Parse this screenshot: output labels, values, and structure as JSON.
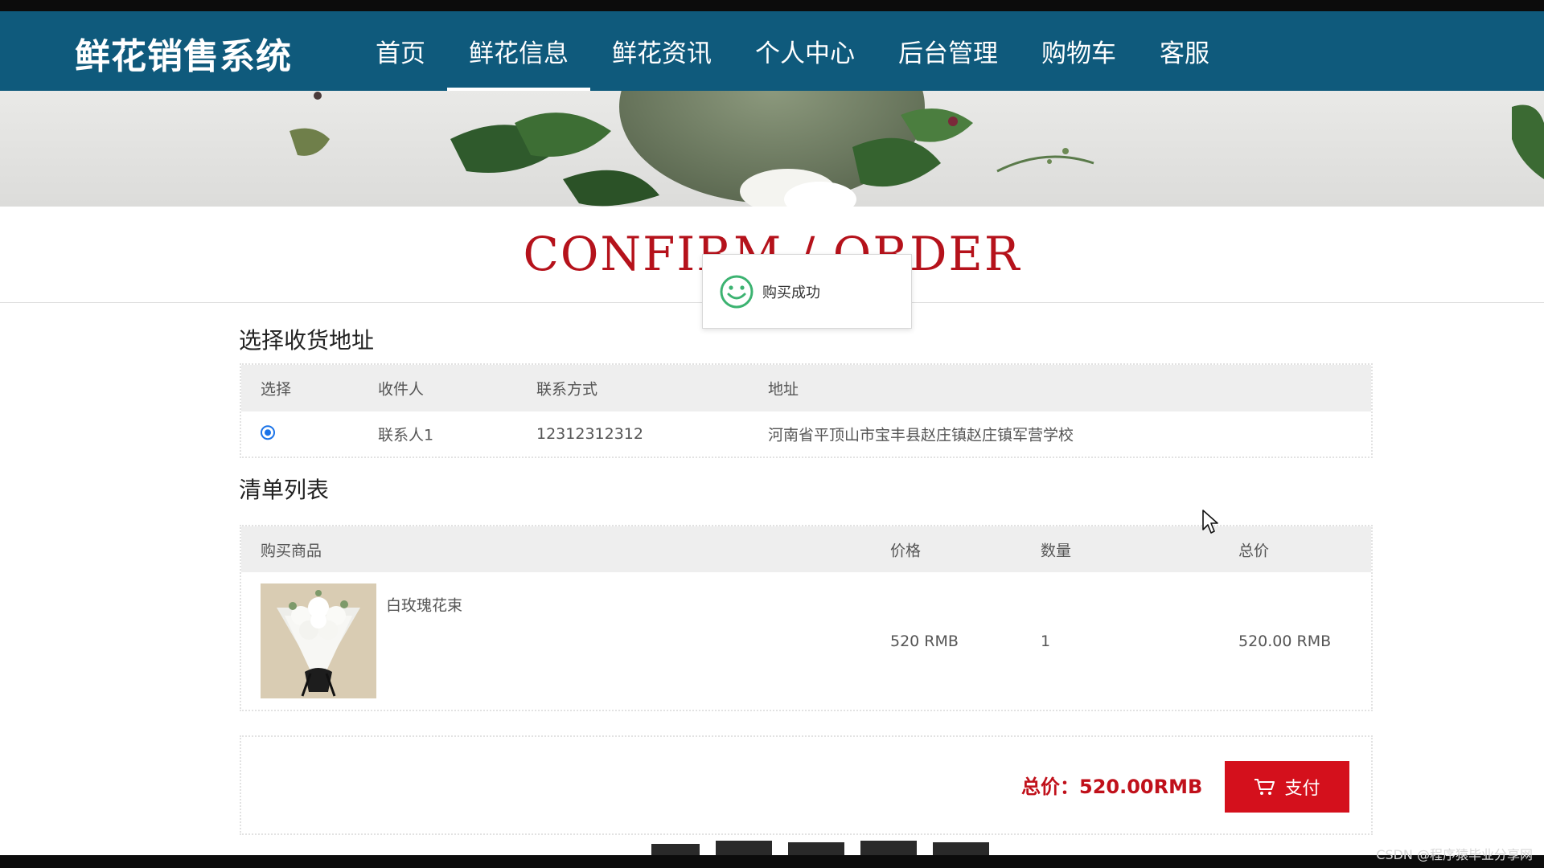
{
  "header": {
    "brand": "鲜花销售系统",
    "nav": [
      {
        "label": "首页"
      },
      {
        "label": "鲜花信息"
      },
      {
        "label": "鲜花资讯"
      },
      {
        "label": "个人中心"
      },
      {
        "label": "后台管理"
      },
      {
        "label": "购物车"
      },
      {
        "label": "客服"
      }
    ]
  },
  "page": {
    "title": "CONFIRM / ORDER"
  },
  "toast": {
    "icon": "smile-icon",
    "message": "购买成功"
  },
  "address_section": {
    "heading": "选择收货地址",
    "columns": [
      "选择",
      "收件人",
      "联系方式",
      "地址"
    ],
    "rows": [
      {
        "selected": true,
        "recipient": "联系人1",
        "phone": "12312312312",
        "address": "河南省平顶山市宝丰县赵庄镇赵庄镇军营学校"
      }
    ]
  },
  "items_section": {
    "heading": "清单列表",
    "columns": [
      "购买商品",
      "价格",
      "数量",
      "总价"
    ],
    "rows": [
      {
        "name": "白玫瑰花束",
        "price": "520 RMB",
        "quantity": "1",
        "subtotal": "520.00 RMB"
      }
    ]
  },
  "summary": {
    "total_label": "总价：520.00RMB",
    "pay_label": "支付",
    "pay_icon": "cart-icon"
  },
  "watermark": "CSDN @程序猿毕业分享网",
  "colors": {
    "header_bg": "#0f5a7c",
    "accent_red": "#b5121b",
    "button_red": "#d4101c",
    "radio_blue": "#1a73e8"
  }
}
